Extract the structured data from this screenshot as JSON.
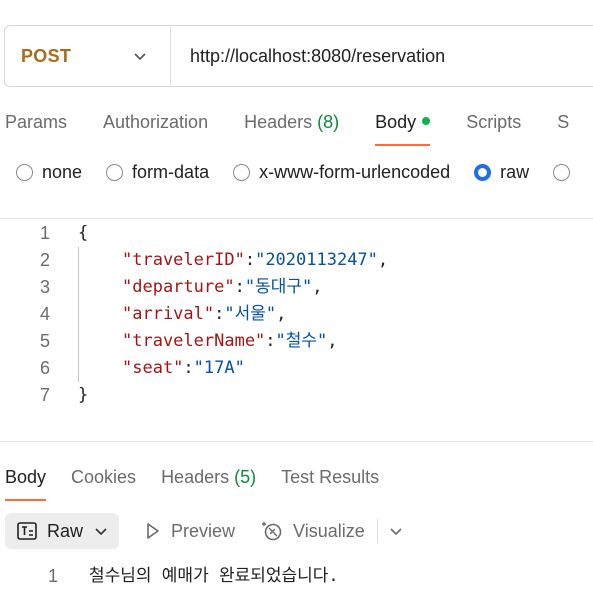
{
  "request": {
    "method": "POST",
    "url": "http://localhost:8080/reservation"
  },
  "tabs": {
    "params": "Params",
    "authorization": "Authorization",
    "headers": "Headers",
    "headers_count": "(8)",
    "body": "Body",
    "scripts": "Scripts",
    "settings_partial": "S"
  },
  "body_types": {
    "none": "none",
    "form_data": "form-data",
    "urlencoded": "x-www-form-urlencoded",
    "raw": "raw",
    "selected": "raw"
  },
  "editor": {
    "lines": [
      {
        "n": "1",
        "open": "{"
      },
      {
        "n": "2",
        "key": "\"travelerID\"",
        "value": "\"2020113247\"",
        "comma": ","
      },
      {
        "n": "3",
        "key": "\"departure\"",
        "value": "\"동대구\"",
        "comma": ","
      },
      {
        "n": "4",
        "key": "\"arrival\"",
        "value": "\"서울\"",
        "comma": ","
      },
      {
        "n": "5",
        "key": "\"travelerName\"",
        "value": "\"철수\"",
        "comma": ","
      },
      {
        "n": "6",
        "key": "\"seat\"",
        "value": "\"17A\"",
        "comma": ""
      },
      {
        "n": "7",
        "close": "}"
      }
    ]
  },
  "response_tabs": {
    "body": "Body",
    "cookies": "Cookies",
    "headers": "Headers",
    "headers_count": "(5)",
    "test_results": "Test Results"
  },
  "response_toolbar": {
    "raw": "Raw",
    "preview": "Preview",
    "visualize": "Visualize"
  },
  "response": {
    "line_number": "1",
    "text": "철수님의 예매가 완료되었습니다."
  },
  "colors": {
    "method": "#ab6b1b",
    "active_tab_underline": "#ff6c37",
    "body_dot": "#12b04a",
    "radio_selected": "#1f6fe5",
    "json_key": "#a31515",
    "json_string": "#0451a5"
  }
}
